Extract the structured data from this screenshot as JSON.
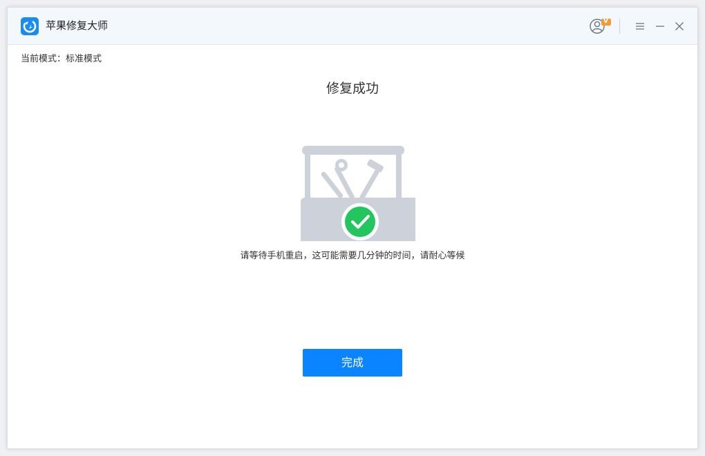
{
  "window": {
    "title": "苹果修复大师",
    "icons": {
      "logo": "refresh-logo-icon",
      "user": "user-vip-icon",
      "menu": "hamburger-menu-icon",
      "minimize": "minimize-icon",
      "close": "close-icon"
    },
    "vip_badge": "V"
  },
  "main": {
    "mode_label": "当前模式：标准模式",
    "status_title": "修复成功",
    "illustration_icon": "toolbox-success-icon",
    "hint": "请等待手机重启，这可能需要几分钟的时间，请耐心等候",
    "done_button": "完成"
  },
  "colors": {
    "accent": "#0a84ff",
    "success": "#22c55e",
    "illustration_gray": "#cdd2da",
    "vip_badge": "#f29b38"
  }
}
